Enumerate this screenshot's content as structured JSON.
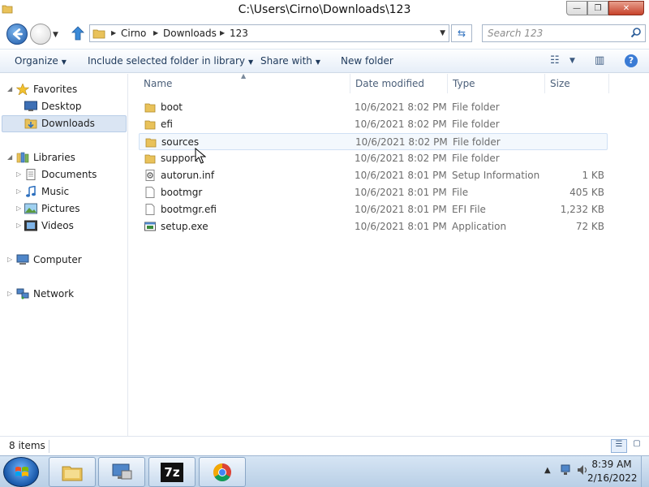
{
  "window": {
    "title": "C:\\Users\\Cirno\\Downloads\\123",
    "minimize_glyph": "—",
    "maximize_glyph": "❐",
    "close_glyph": "✕"
  },
  "address": {
    "crumbs": [
      "Cirno",
      "Downloads",
      "123"
    ]
  },
  "search": {
    "placeholder": "Search 123"
  },
  "toolbar": {
    "organize": "Organize",
    "include": "Include selected folder in library",
    "share": "Share with",
    "new_folder": "New folder"
  },
  "sidebar": {
    "favorites": "Favorites",
    "desktop": "Desktop",
    "downloads": "Downloads",
    "libraries": "Libraries",
    "documents": "Documents",
    "music": "Music",
    "pictures": "Pictures",
    "videos": "Videos",
    "computer": "Computer",
    "network": "Network"
  },
  "columns": {
    "name": "Name",
    "date": "Date modified",
    "type": "Type",
    "size": "Size"
  },
  "files": [
    {
      "name": "boot",
      "date": "10/6/2021 8:02 PM",
      "type": "File folder",
      "size": "",
      "icon": "folder-icon"
    },
    {
      "name": "efi",
      "date": "10/6/2021 8:02 PM",
      "type": "File folder",
      "size": "",
      "icon": "folder-icon"
    },
    {
      "name": "sources",
      "date": "10/6/2021 8:02 PM",
      "type": "File folder",
      "size": "",
      "icon": "folder-icon"
    },
    {
      "name": "support",
      "date": "10/6/2021 8:02 PM",
      "type": "File folder",
      "size": "",
      "icon": "folder-icon"
    },
    {
      "name": "autorun.inf",
      "date": "10/6/2021 8:01 PM",
      "type": "Setup Information",
      "size": "1 KB",
      "icon": "settings-file-icon"
    },
    {
      "name": "bootmgr",
      "date": "10/6/2021 8:01 PM",
      "type": "File",
      "size": "405 KB",
      "icon": "blank-file-icon"
    },
    {
      "name": "bootmgr.efi",
      "date": "10/6/2021 8:01 PM",
      "type": "EFI File",
      "size": "1,232 KB",
      "icon": "blank-file-icon"
    },
    {
      "name": "setup.exe",
      "date": "10/6/2021 8:01 PM",
      "type": "Application",
      "size": "72 KB",
      "icon": "application-icon"
    }
  ],
  "status": {
    "item_count": "8 items"
  },
  "taskbar": {
    "sevenzip_label": "7z"
  },
  "clock": {
    "time": "8:39 AM",
    "date": "2/16/2022"
  },
  "colors": {
    "accent": "#3a7bd5",
    "folder": "#e9c25a",
    "selection": "#dae5f3"
  }
}
